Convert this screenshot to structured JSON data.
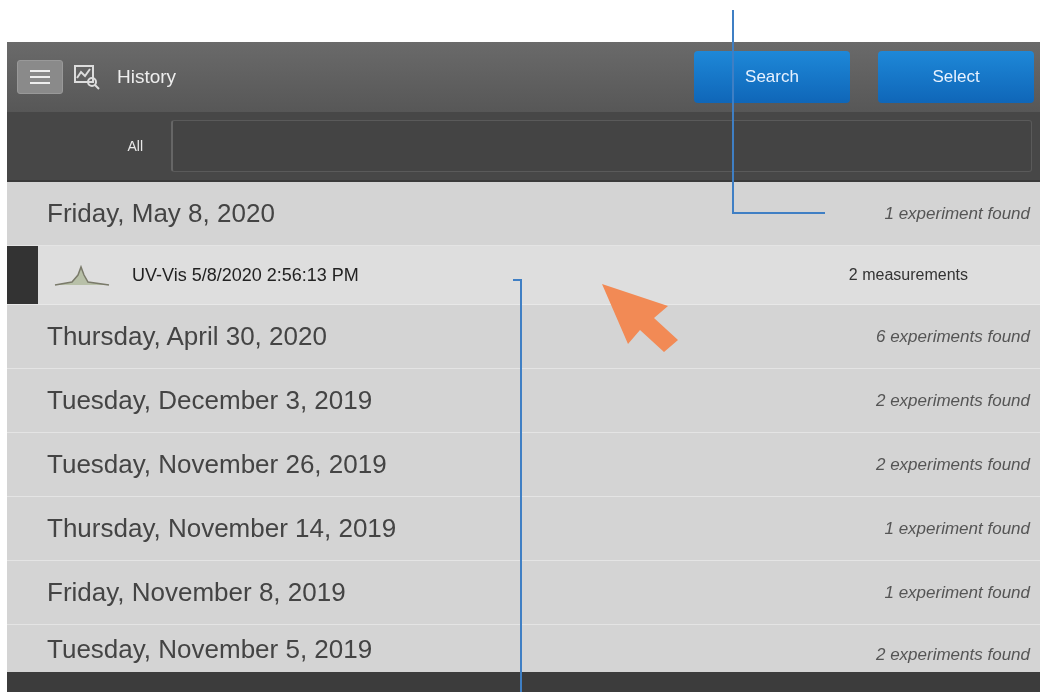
{
  "header": {
    "title": "History",
    "buttons": [
      "Search",
      "Select"
    ]
  },
  "filter": {
    "label": "All"
  },
  "groups": [
    {
      "date": "Friday, May 8, 2020",
      "count": "1 experiment found",
      "items": [
        {
          "name": "UV-Vis 5/8/2020 2:56:13 PM",
          "count": "2 measurements",
          "selected": true
        }
      ]
    },
    {
      "date": "Thursday, April 30, 2020",
      "count": "6 experiments found"
    },
    {
      "date": "Tuesday, December 3, 2019",
      "count": "2 experiments found"
    },
    {
      "date": "Tuesday, November 26, 2019",
      "count": "2 experiments found"
    },
    {
      "date": "Thursday, November 14, 2019",
      "count": "1 experiment found"
    },
    {
      "date": "Friday, November 8, 2019",
      "count": "1 experiment found"
    },
    {
      "date": "Tuesday, November 5, 2019",
      "count": "2 experiments found"
    }
  ]
}
